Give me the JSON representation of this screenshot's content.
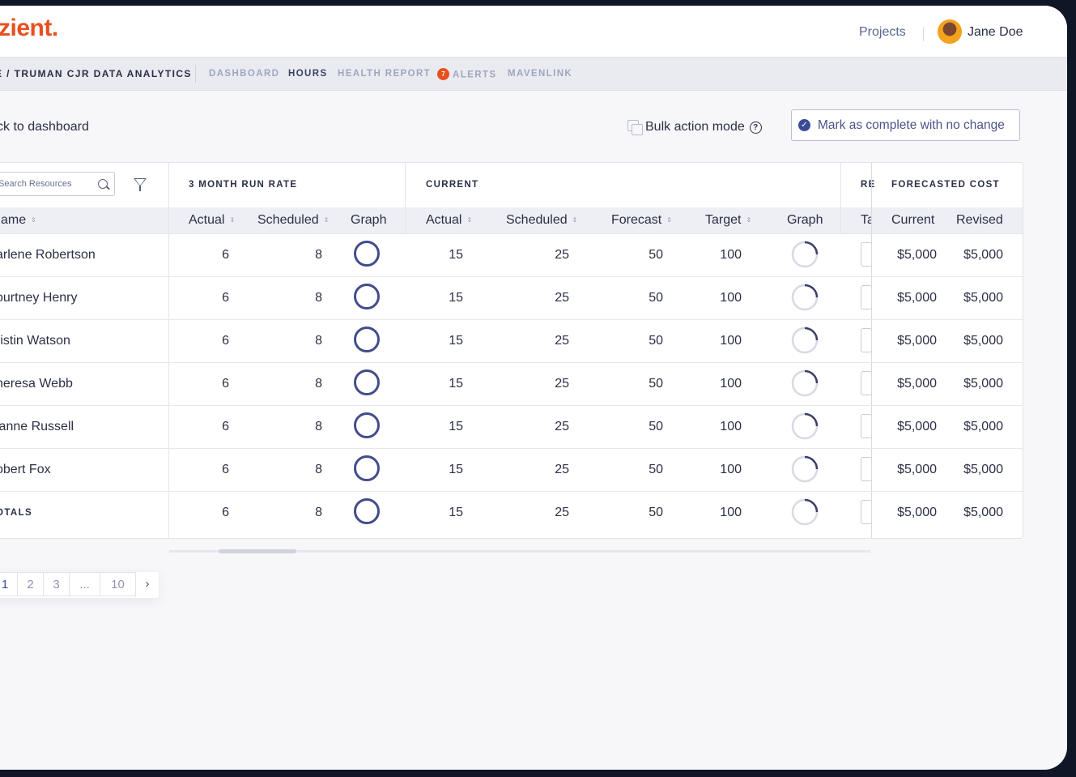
{
  "header": {
    "logo_text": "zient",
    "logo_dot": ".",
    "projects_link": "Projects",
    "user_name": "Jane Doe"
  },
  "subnav": {
    "breadcrumb": "E / TRUMAN CJR DATA ANALYTICS",
    "tabs": [
      {
        "label": "DASHBOARD",
        "active": false
      },
      {
        "label": "HOURS",
        "active": true
      },
      {
        "label": "HEALTH REPORT",
        "active": false
      },
      {
        "label": "ALERTS",
        "active": false,
        "badge": "7"
      },
      {
        "label": "MAVENLINK",
        "active": false
      }
    ]
  },
  "toolbar": {
    "back_link": "ck to dashboard",
    "bulk_action_label": "Bulk action mode",
    "help_glyph": "?",
    "mark_complete_label": "Mark as complete with no change"
  },
  "table": {
    "search_placeholder": "Search Resources",
    "groups": {
      "run_rate": "3 MONTH RUN RATE",
      "current": "CURRENT",
      "revised_partial": "RE",
      "forecasted_cost": "FORECASTED COST"
    },
    "columns": {
      "name": "ame",
      "rr_actual": "Actual",
      "rr_scheduled": "Scheduled",
      "rr_graph": "Graph",
      "cur_actual": "Actual",
      "cur_scheduled": "Scheduled",
      "cur_forecast": "Forecast",
      "cur_target": "Target",
      "cur_graph": "Graph",
      "rev_partial": "Ta",
      "cost_current": "Current",
      "cost_revised": "Revised"
    },
    "rows": [
      {
        "name": "arlene Robertson",
        "rr_actual": "6",
        "rr_scheduled": "8",
        "cur_actual": "15",
        "cur_scheduled": "25",
        "cur_forecast": "50",
        "cur_target": "100",
        "cost_current": "$5,000",
        "cost_revised": "$5,000"
      },
      {
        "name": "ourtney Henry",
        "rr_actual": "6",
        "rr_scheduled": "8",
        "cur_actual": "15",
        "cur_scheduled": "25",
        "cur_forecast": "50",
        "cur_target": "100",
        "cost_current": "$5,000",
        "cost_revised": "$5,000"
      },
      {
        "name": "ristin Watson",
        "rr_actual": "6",
        "rr_scheduled": "8",
        "cur_actual": "15",
        "cur_scheduled": "25",
        "cur_forecast": "50",
        "cur_target": "100",
        "cost_current": "$5,000",
        "cost_revised": "$5,000"
      },
      {
        "name": "heresa Webb",
        "rr_actual": "6",
        "rr_scheduled": "8",
        "cur_actual": "15",
        "cur_scheduled": "25",
        "cur_forecast": "50",
        "cur_target": "100",
        "cost_current": "$5,000",
        "cost_revised": "$5,000"
      },
      {
        "name": "ianne Russell",
        "rr_actual": "6",
        "rr_scheduled": "8",
        "cur_actual": "15",
        "cur_scheduled": "25",
        "cur_forecast": "50",
        "cur_target": "100",
        "cost_current": "$5,000",
        "cost_revised": "$5,000"
      },
      {
        "name": "obert Fox",
        "rr_actual": "6",
        "rr_scheduled": "8",
        "cur_actual": "15",
        "cur_scheduled": "25",
        "cur_forecast": "50",
        "cur_target": "100",
        "cost_current": "$5,000",
        "cost_revised": "$5,000"
      }
    ],
    "totals": {
      "label": "OTALS",
      "rr_actual": "6",
      "rr_scheduled": "8",
      "cur_actual": "15",
      "cur_scheduled": "25",
      "cur_forecast": "50",
      "cur_target": "100",
      "cost_current": "$5,000",
      "cost_revised": "$5,000"
    }
  },
  "pagination": {
    "pages": [
      "1",
      "2",
      "3",
      "...",
      "10"
    ],
    "active_page": "1",
    "next_glyph": "›"
  },
  "colors": {
    "brand_orange": "#e8501f",
    "accent_navy": "#3b4a96",
    "ring_full": "#434c8a",
    "ring_partial_track": "#d7d9e4"
  }
}
